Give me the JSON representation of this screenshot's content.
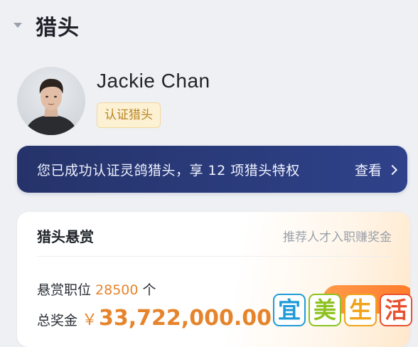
{
  "header": {
    "title": "猎头"
  },
  "profile": {
    "name": "Jackie Chan",
    "badge": "认证猎头"
  },
  "privilege_banner": {
    "text": "您已成功认证灵鸽猎头，享 12 项猎头特权",
    "link_label": "查看"
  },
  "bounty_card": {
    "title": "猎头悬赏",
    "subtitle": "推荐人才入职赚奖金",
    "positions_label": "悬赏职位",
    "positions_count": "28500",
    "positions_unit": "个",
    "total_label": "总奖金",
    "currency": "￥",
    "total_amount": "33,722,000.00"
  },
  "watermark": {
    "text": "宜美生活",
    "colors": [
      "#1f9bd8",
      "#8dc21f",
      "#f0a31b",
      "#e8502f"
    ]
  },
  "colors": {
    "banner_bg": "#2b3c7d",
    "accent_orange": "#e6842c",
    "badge_bg": "#fdf1d3",
    "badge_text": "#b88525"
  }
}
